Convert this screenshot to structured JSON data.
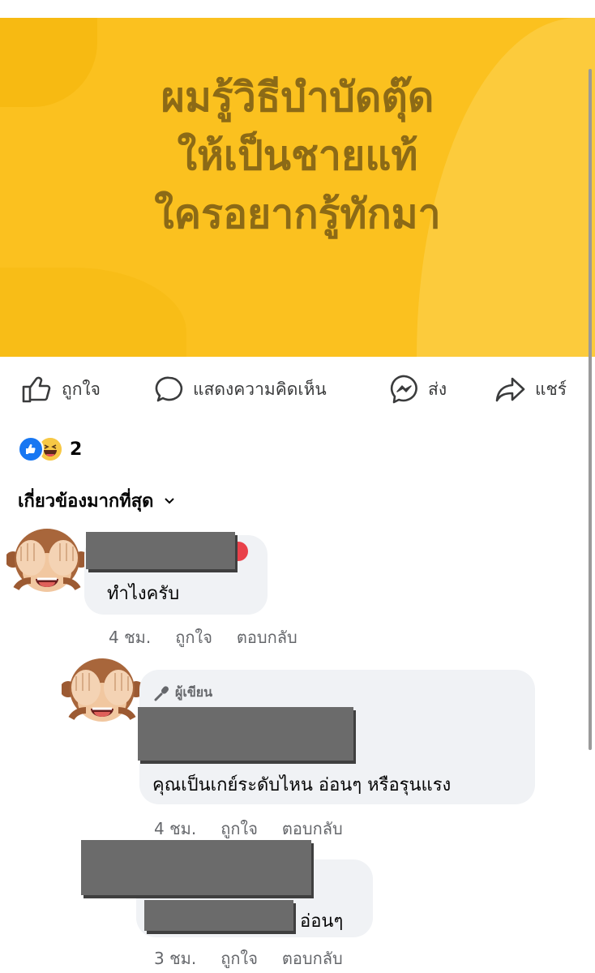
{
  "post": {
    "lines": [
      "ผมรู้วิธีบำบัดตุ๊ด",
      "ให้เป็นชายแท้",
      "ใครอยากรู้ทักมา"
    ],
    "background_color": "#fbc11f",
    "text_color": "#8c6a16"
  },
  "actions": {
    "like": "ถูกใจ",
    "comment": "แสดงความคิดเห็น",
    "send": "ส่ง",
    "share": "แชร์"
  },
  "reactions": {
    "icons": [
      "like-icon",
      "haha-icon"
    ],
    "count": "2"
  },
  "sort_label": "เกี่ยวข้องมากที่สุด",
  "comments": [
    {
      "text": "ทำไงครับ",
      "time": "4 ชม.",
      "like": "ถูกใจ",
      "reply": "ตอบกลับ"
    },
    {
      "badge": "ผู้เขียน",
      "text": "คุณเป็นเกย์ระดับไหน อ่อนๆ หรือรุนแรง",
      "time": "4 ชม.",
      "like": "ถูกใจ",
      "reply": "ตอบกลับ"
    },
    {
      "text": "อ่อนๆ",
      "time": "3 ชม.",
      "like": "ถูกใจ",
      "reply": "ตอบกลับ"
    }
  ],
  "colors": {
    "accent": "#1877f2",
    "bubble": "#f0f2f5",
    "meta": "#65676b"
  }
}
